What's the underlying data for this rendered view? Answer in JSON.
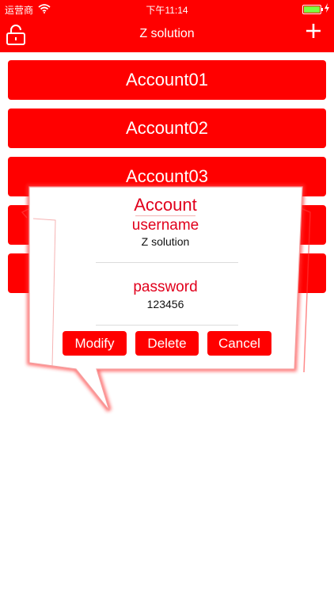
{
  "status_bar": {
    "carrier": "运营商",
    "time": "下午11:14"
  },
  "header": {
    "title": "Z solution",
    "left_icon": "lock-icon",
    "right_icon": "plus-icon",
    "accent": "#ff0000"
  },
  "accounts": [
    {
      "label": "Account01"
    },
    {
      "label": "Account02"
    },
    {
      "label": "Account03"
    },
    {
      "label": ""
    },
    {
      "label": ""
    }
  ],
  "dialog": {
    "title": "Account",
    "username_label": "username",
    "username_value": "Z solution",
    "password_label": "password",
    "password_value": "123456",
    "buttons": {
      "modify": "Modify",
      "delete": "Delete",
      "cancel": "Cancel"
    }
  }
}
